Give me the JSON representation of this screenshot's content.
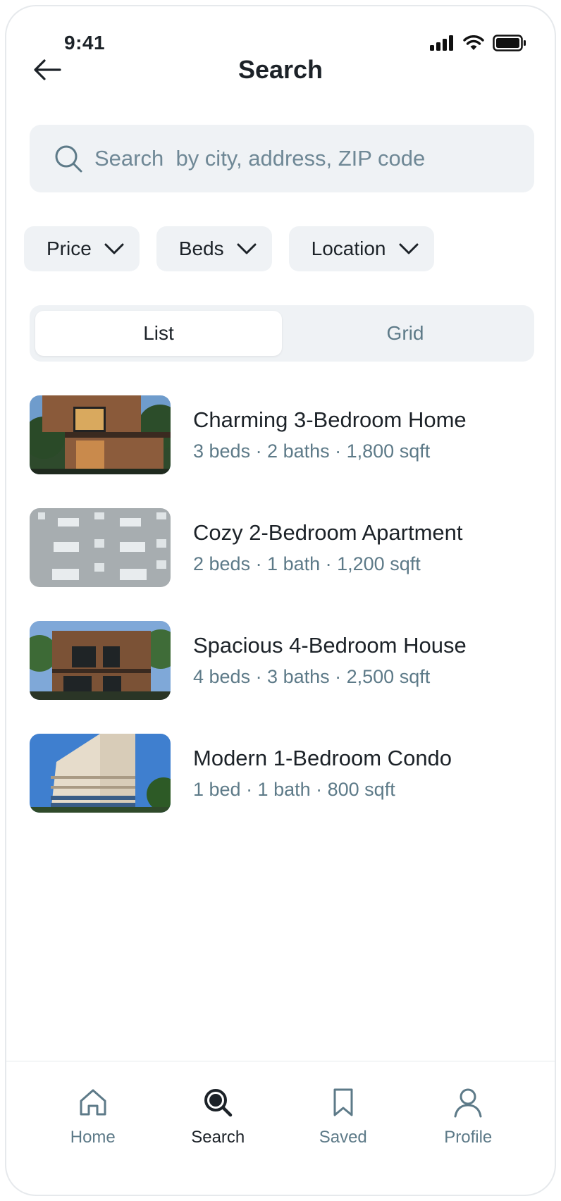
{
  "status_bar": {
    "time": "9:41"
  },
  "header": {
    "title": "Search"
  },
  "search": {
    "placeholder": "Search  by city, address, ZIP code"
  },
  "filters": [
    {
      "label": "Price"
    },
    {
      "label": "Beds"
    },
    {
      "label": "Location"
    }
  ],
  "view_toggle": {
    "list_label": "List",
    "grid_label": "Grid",
    "selected": "List"
  },
  "listings": [
    {
      "title": "Charming 3-Bedroom Home",
      "details": "3 beds · 2 baths · 1,800 sqft"
    },
    {
      "title": "Cozy 2-Bedroom Apartment",
      "details": "2 beds · 1 bath · 1,200 sqft"
    },
    {
      "title": "Spacious 4-Bedroom House",
      "details": "4 beds · 3 baths · 2,500 sqft"
    },
    {
      "title": "Modern 1-Bedroom Condo",
      "details": "1 bed · 1 bath · 800 sqft"
    }
  ],
  "tab_bar": {
    "items": [
      {
        "label": "Home",
        "icon": "home-icon",
        "active": false
      },
      {
        "label": "Search",
        "icon": "search-icon",
        "active": true
      },
      {
        "label": "Saved",
        "icon": "bookmark-icon",
        "active": false
      },
      {
        "label": "Profile",
        "icon": "user-icon",
        "active": false
      }
    ]
  },
  "colors": {
    "text_primary": "#1c2228",
    "text_secondary": "#5d7a88",
    "surface": "#eff2f5",
    "background": "#ffffff"
  }
}
